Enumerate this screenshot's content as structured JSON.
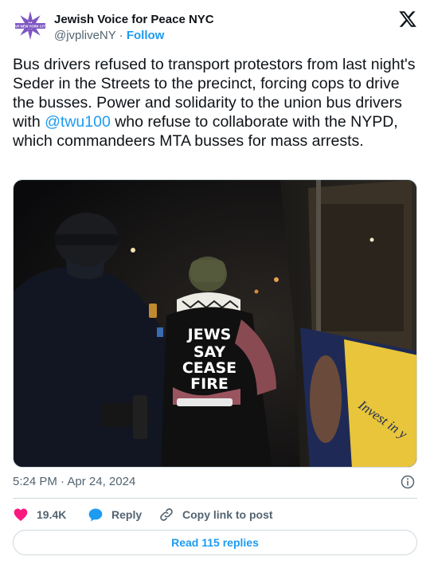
{
  "author": {
    "name": "Jewish Voice for Peace NYC",
    "handle": "@jvpliveNY",
    "separator": "·",
    "follow_label": "Follow",
    "avatar_text": "JVP NEW YORK CITY",
    "avatar_color": "#7e57c2"
  },
  "tweet": {
    "text_before": "Bus drivers refused to transport protestors from last night's Seder in the Streets to the precinct, forcing cops to drive the busses. Power and solidarity to the union bus drivers with ",
    "mention": "@twu100",
    "text_after": " who refuse to collaborate with the NYPD, which commandeers MTA busses for mass arrests."
  },
  "media": {
    "shirt_lines": [
      "JEWS",
      "SAY",
      "CEASE",
      "FIRE"
    ],
    "bus_ad_text": "Invest in y"
  },
  "meta": {
    "time": "5:24 PM",
    "separator": "·",
    "date": "Apr 24, 2024"
  },
  "actions": {
    "like_count": "19.4K",
    "reply_label": "Reply",
    "copy_label": "Copy link to post"
  },
  "read_replies_label": "Read 115 replies",
  "colors": {
    "accent": "#1d9bf0",
    "like": "#f91880",
    "muted": "#536471",
    "border": "#cfd9de"
  }
}
